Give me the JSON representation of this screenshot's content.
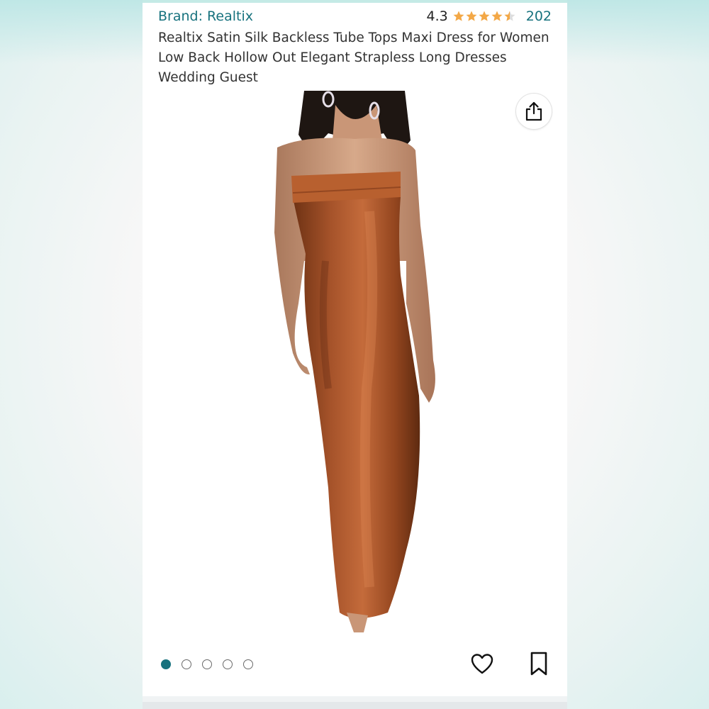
{
  "product": {
    "brand": "Brand: Realtix",
    "rating": "4.3",
    "rating_value": 4.3,
    "review_count": "202",
    "title": "Realtix Satin Silk Backless Tube Tops Maxi Dress for Women Low Back Hollow Out Elegant Strapless Long Dresses Wedding Guest"
  },
  "gallery": {
    "image_count": 5,
    "active_index": 0,
    "image_alt": "model wearing rust satin strapless maxi dress"
  },
  "icons": {
    "share": "share-icon",
    "heart": "heart-icon",
    "bookmark": "bookmark-icon",
    "star": "star-icon"
  },
  "colors": {
    "link": "#17727e",
    "star": "#f3a847",
    "dress": "#9a4a26"
  }
}
